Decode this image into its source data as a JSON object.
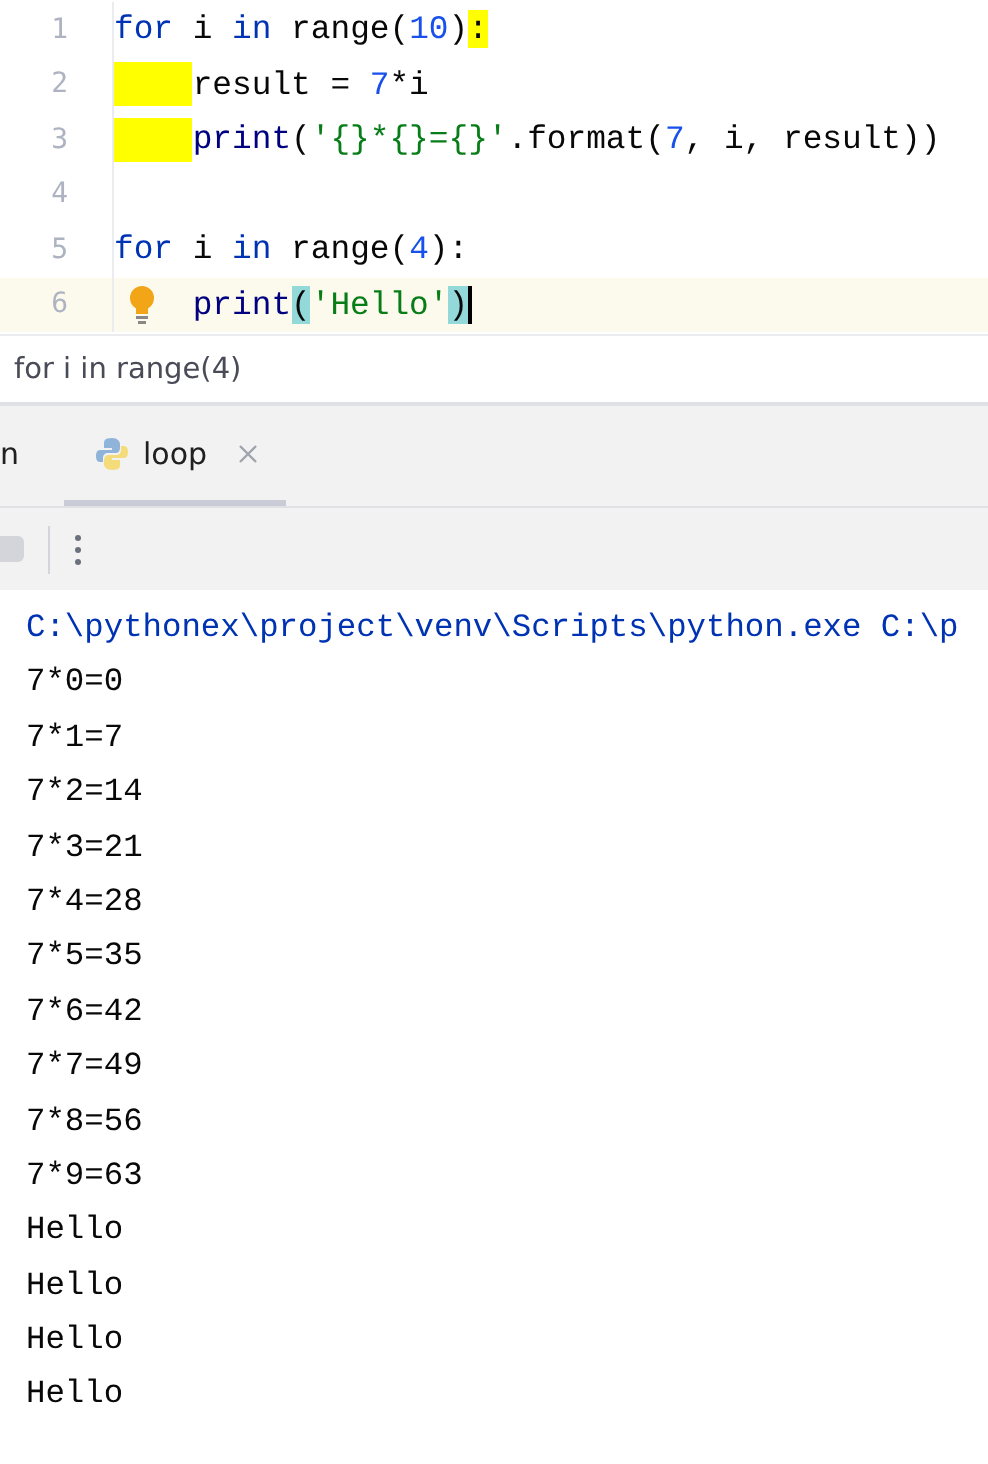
{
  "editor": {
    "lines": [
      {
        "number": "1",
        "current": false,
        "bulb": false,
        "caret": false,
        "tokens": [
          {
            "text": "for",
            "kind": "keyword"
          },
          {
            "text": " i ",
            "kind": "plain"
          },
          {
            "text": "in",
            "kind": "keyword"
          },
          {
            "text": " range(",
            "kind": "plain"
          },
          {
            "text": "10",
            "kind": "number"
          },
          {
            "text": ")",
            "kind": "plain"
          },
          {
            "text": ":",
            "kind": "plain",
            "highlighted": true
          }
        ]
      },
      {
        "number": "2",
        "current": false,
        "bulb": false,
        "caret": false,
        "indented": true,
        "indent_highlighted": true,
        "tokens": [
          {
            "text": "result = ",
            "kind": "plain"
          },
          {
            "text": "7",
            "kind": "number"
          },
          {
            "text": "*i",
            "kind": "plain"
          }
        ]
      },
      {
        "number": "3",
        "current": false,
        "bulb": false,
        "caret": false,
        "indented": true,
        "indent_highlighted": true,
        "tokens": [
          {
            "text": "print",
            "kind": "builtin"
          },
          {
            "text": "(",
            "kind": "plain"
          },
          {
            "text": "'{}*{}={}'",
            "kind": "string"
          },
          {
            "text": ".format(",
            "kind": "plain"
          },
          {
            "text": "7",
            "kind": "number"
          },
          {
            "text": ", i, result))",
            "kind": "plain"
          }
        ]
      },
      {
        "number": "4",
        "current": false,
        "bulb": false,
        "caret": false
      },
      {
        "number": "5",
        "current": false,
        "bulb": false,
        "caret": false,
        "tokens": [
          {
            "text": "for",
            "kind": "keyword"
          },
          {
            "text": " i ",
            "kind": "plain"
          },
          {
            "text": "in",
            "kind": "keyword"
          },
          {
            "text": " range(",
            "kind": "plain"
          },
          {
            "text": "4",
            "kind": "number"
          },
          {
            "text": "):",
            "kind": "plain"
          }
        ]
      },
      {
        "number": "6",
        "current": true,
        "bulb": true,
        "caret": true,
        "indented": true,
        "indent_highlighted": false,
        "tokens": [
          {
            "text": "print",
            "kind": "builtin"
          },
          {
            "text": "(",
            "kind": "plain",
            "matched": true
          },
          {
            "text": "'Hello'",
            "kind": "string"
          },
          {
            "text": ")",
            "kind": "plain",
            "matched": true
          }
        ]
      }
    ]
  },
  "breadcrumb": "for i in range(4)",
  "run_panel": {
    "tabs": [
      {
        "label": "n",
        "selected": false,
        "closable": false
      },
      {
        "label": "loop",
        "selected": true,
        "closable": true
      }
    ],
    "toolbar": {
      "stop_disabled": true
    },
    "console": [
      {
        "text": "C:\\pythonex\\project\\venv\\Scripts\\python.exe C:\\p",
        "kind": "command"
      },
      {
        "text": "7*0=0",
        "kind": "output"
      },
      {
        "text": "7*1=7",
        "kind": "output"
      },
      {
        "text": "7*2=14",
        "kind": "output"
      },
      {
        "text": "7*3=21",
        "kind": "output"
      },
      {
        "text": "7*4=28",
        "kind": "output"
      },
      {
        "text": "7*5=35",
        "kind": "output"
      },
      {
        "text": "7*6=42",
        "kind": "output"
      },
      {
        "text": "7*7=49",
        "kind": "output"
      },
      {
        "text": "7*8=56",
        "kind": "output"
      },
      {
        "text": "7*9=63",
        "kind": "output"
      },
      {
        "text": "Hello",
        "kind": "output"
      },
      {
        "text": "Hello",
        "kind": "output"
      },
      {
        "text": "Hello",
        "kind": "output"
      },
      {
        "text": "Hello",
        "kind": "output"
      }
    ]
  }
}
